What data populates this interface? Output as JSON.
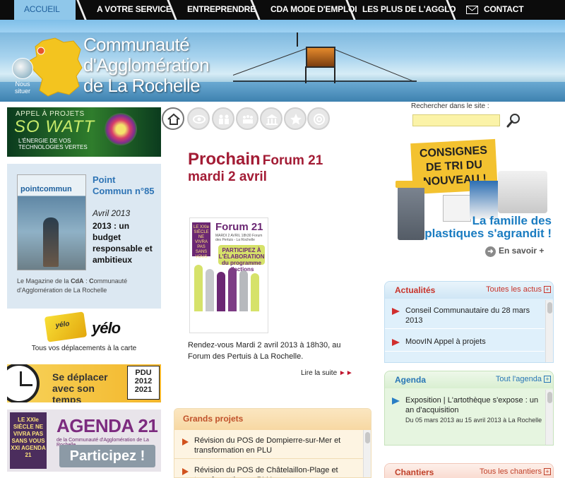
{
  "nav": {
    "items": [
      "ACCUEIL",
      "A VOTRE SERVICE",
      "ENTREPRENDRE",
      "CDA MODE D'EMPLOI",
      "LES PLUS DE L'AGGLO",
      "CONTACT"
    ]
  },
  "header": {
    "title_line1": "Communauté",
    "title_line2": "d'Agglomération",
    "title_line3": "de La Rochelle",
    "locate_label": "Nous situer"
  },
  "search": {
    "label": "Rechercher dans le site :",
    "value": ""
  },
  "sowatt": {
    "line1": "APPEL À PROJETS",
    "line2": "SO WATT",
    "line3": "L'ÉNERGIE DE VOS TECHNOLOGIES VERTES"
  },
  "magazine": {
    "cover_logo": "pointcommun",
    "title": "Point Commun n°85",
    "date": "Avril 2013",
    "headline": "2013 : un budget responsable et ambitieux",
    "caption_pre": "Le Magazine de la ",
    "caption_bold1": "CdA",
    "caption_mid": " : ",
    "caption_bold2": "C",
    "caption_post": "ommunauté d'Agglomération de La Rochelle"
  },
  "yelo": {
    "card_text": "yélo",
    "logo": "yélo",
    "caption": "Tous vos déplacements à la carte"
  },
  "pdu": {
    "text": "Se déplacer avec son temps",
    "badge_line1": "PDU",
    "badge_line2": "2012",
    "badge_line3": "2021"
  },
  "agenda21_banner": {
    "left_text": "LE XXIe SIÈCLE NE VIVRA PAS SANS VOUS XXI AGENDA 21",
    "big": "AGENDA 21",
    "small": "de la Communauté d'Agglomération de La Rochelle",
    "button": "Participez !"
  },
  "icons": [
    "home-icon",
    "eye-icon",
    "people-icon",
    "community-icon",
    "building-icon",
    "star-icon",
    "at-icon"
  ],
  "event": {
    "title_big": "Prochain",
    "title_rest": "Forum 21",
    "date": "mardi 2 avril",
    "poster_tag": "LE XXIe SIÈCLE NE VIVRA PAS SANS VOUS",
    "poster_title": "Forum 21",
    "poster_sub": "MARDI 2 AVRIL 18h30 Forum des Pertuis - La Rochelle",
    "poster_bubble": "PARTICIPEZ À L'ÉLABORATION du programme d'actions",
    "text": "Rendez-vous Mardi 2 avril 2013 à 18h30, au Forum des Pertuis à La Rochelle.",
    "read_more": "Lire la suite"
  },
  "grands_projets": {
    "title": "Grands projets",
    "items": [
      "Révision du POS de Dompierre-sur-Mer et transformation en PLU",
      "Révision du POS de Châtelaillon-Plage et transformation en PLU"
    ]
  },
  "tri": {
    "sticker": "CONSIGNES DE TRI DU NOUVEAU !",
    "message": "La famille des plastiques s'agrandit !",
    "more": "En savoir +"
  },
  "actus": {
    "title": "Actualités",
    "all": "Toutes les actus",
    "items": [
      "Conseil Communautaire du 28 mars 2013",
      "MoovIN Appel à projets"
    ]
  },
  "agenda": {
    "title": "Agenda",
    "all": "Tout l'agenda",
    "items": [
      {
        "title": "Exposition | L'artothèque s'expose : un an d'acquisition",
        "dates": "Du 05 mars 2013 au 15 avril 2013 à La Rochelle"
      }
    ]
  },
  "chantiers": {
    "title": "Chantiers",
    "all": "Tous les chantiers"
  },
  "colors": {
    "nav_bg": "#0c0c0c",
    "accent_red": "#a31c35",
    "link_blue": "#2876b5"
  }
}
